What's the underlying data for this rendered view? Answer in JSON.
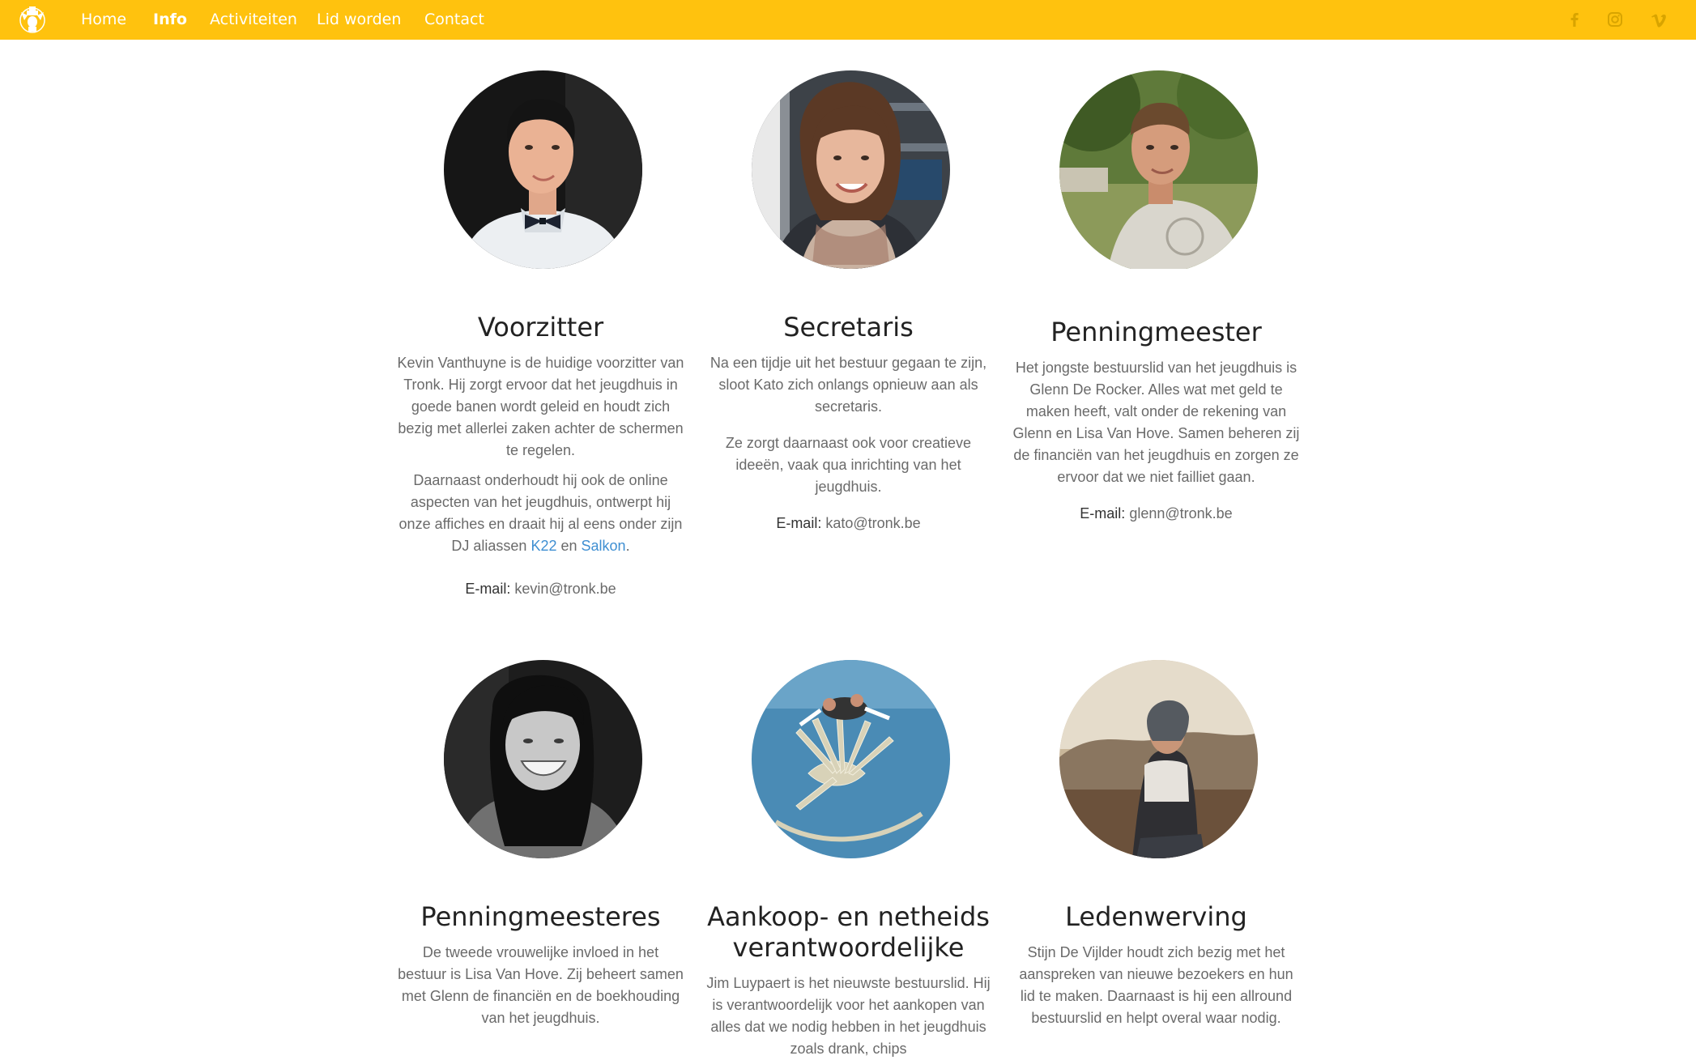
{
  "nav": {
    "items": [
      {
        "label": "Home",
        "active": false
      },
      {
        "label": "Info",
        "active": true
      },
      {
        "label": "Activiteiten",
        "active": false
      },
      {
        "label": "Lid worden",
        "active": false
      },
      {
        "label": "Contact",
        "active": false
      }
    ],
    "social_icons": [
      "facebook-icon",
      "instagram-icon",
      "vimeo-icon"
    ],
    "background_color": "#ffc20e",
    "text_color": "#ffffff"
  },
  "board": [
    {
      "role": "Voorzitter",
      "paragraph1": "Kevin Vanthuyne is de huidige voorzitter van Tronk. Hij zorgt ervoor dat het jeugdhuis in goede banen wordt geleid en houdt zich bezig met allerlei zaken achter de schermen te regelen.",
      "paragraph2_before": "Daarnaast onderhoudt hij ook de online aspecten van het jeugdhuis, ontwerpt hij onze affiches en draait hij al eens onder zijn DJ aliassen ",
      "link1": "K22",
      "paragraph2_mid": " en ",
      "link2": "Salkon",
      "paragraph2_after": ".",
      "email_label": "E-mail:",
      "email": "kevin@tronk.be"
    },
    {
      "role": "Secretaris",
      "paragraph1": "Na een tijdje uit het bestuur gegaan te zijn, sloot Kato zich onlangs opnieuw aan als secretaris.",
      "paragraph2": "Ze zorgt daarnaast ook voor creatieve ideeën, vaak qua inrichting van het jeugdhuis.",
      "email_label": "E-mail:",
      "email": "kato@tronk.be"
    },
    {
      "role": "Penningmeester",
      "paragraph1": "Het jongste bestuurslid van het jeugdhuis is Glenn De Rocker. Alles wat met geld te maken heeft, valt onder de rekening van Glenn en Lisa Van Hove. Samen beheren zij de financiën van het jeugdhuis en zorgen ze ervoor dat we niet failliet gaan.",
      "email_label": "E-mail:",
      "email": "glenn@tronk.be"
    },
    {
      "role": "Penningmeesteres",
      "paragraph1": "De tweede vrouwelijke invloed in het bestuur is Lisa Van Hove. Zij beheert samen met Glenn de financiën en de boekhouding van het jeugdhuis."
    },
    {
      "role": "Aankoop- en netheids verantwoordelijke",
      "paragraph1": "Jim Luypaert is het nieuwste bestuurslid. Hij is verantwoordelijk voor het aankopen van alles dat we nodig hebben in het jeugdhuis zoals drank, chips"
    },
    {
      "role": "Ledenwerving",
      "paragraph1": "Stijn De Vijlder houdt zich bezig met het aanspreken van nieuwe bezoekers en hun lid te maken. Daarnaast is hij een allround bestuurslid en helpt overal waar nodig."
    }
  ],
  "colors": {
    "link": "#3f8fd2",
    "body_text": "#6a6a6a",
    "heading": "#222222"
  }
}
